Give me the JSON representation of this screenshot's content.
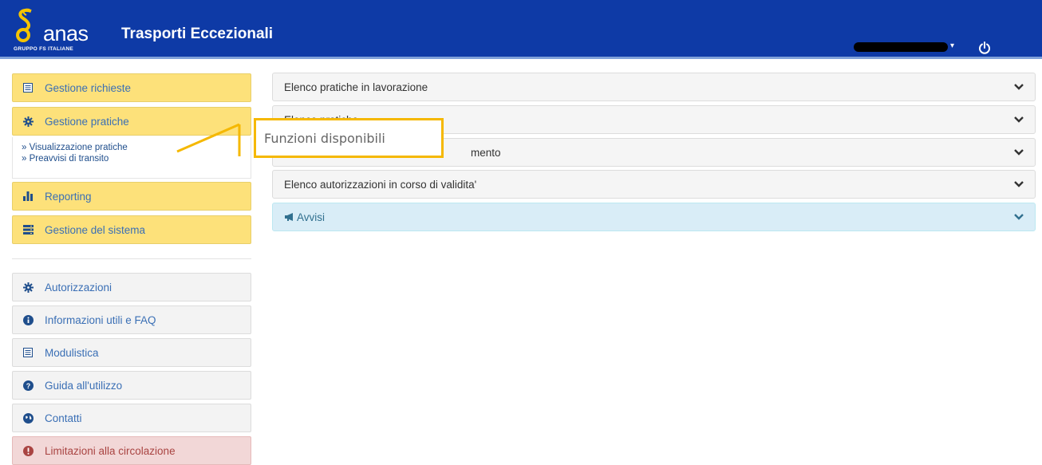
{
  "header": {
    "logo_text": "anas",
    "logo_sub": "GRUPPO FS ITALIANE",
    "app_title": "Trasporti Eccezionali",
    "user_caret": "▾",
    "colors": {
      "bar": "#0e3aa6",
      "accent": "#f5c400"
    }
  },
  "sidebar": {
    "primary": [
      {
        "label": "Gestione richieste",
        "icon": "list-icon"
      },
      {
        "label": "Gestione pratiche",
        "icon": "gear-icon"
      },
      {
        "label": "Reporting",
        "icon": "bar-chart-icon"
      },
      {
        "label": "Gestione del sistema",
        "icon": "server-icon"
      }
    ],
    "submenu": [
      {
        "label": "» Visualizzazione pratiche"
      },
      {
        "label": "» Preavvisi di transito"
      }
    ],
    "secondary": [
      {
        "label": "Autorizzazioni",
        "icon": "gear-icon"
      },
      {
        "label": "Informazioni utili e FAQ",
        "icon": "info-icon"
      },
      {
        "label": "Modulistica",
        "icon": "list-icon"
      },
      {
        "label": "Guida all'utilizzo",
        "icon": "question-icon"
      },
      {
        "label": "Contatti",
        "icon": "globe-icon"
      },
      {
        "label": "Limitazioni alla circolazione",
        "icon": "warning-icon"
      }
    ]
  },
  "panels": [
    {
      "label": "Elenco pratiche in lavorazione"
    },
    {
      "label": "Elenco pratiche ..."
    },
    {
      "label": "mento"
    },
    {
      "label": "Elenco autorizzazioni in corso di validita'"
    },
    {
      "label": "Avvisi",
      "icon": "megaphone-icon"
    }
  ],
  "callout": {
    "label": "Funzioni disponibili"
  }
}
